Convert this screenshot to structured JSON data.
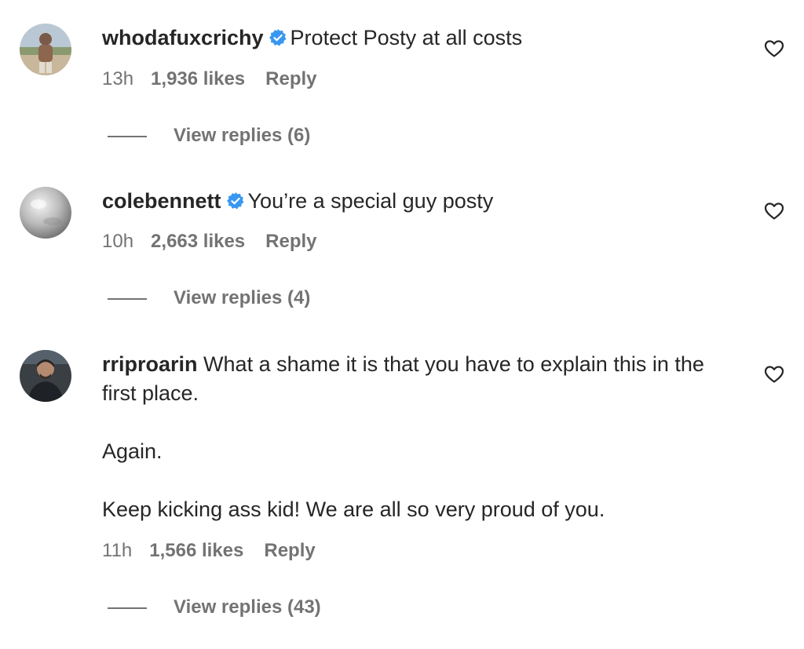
{
  "comments": [
    {
      "username": "whodafuxcrichy",
      "verified": true,
      "text": "Protect Posty at all costs",
      "time": "13h",
      "likes": "1,936 likes",
      "reply_label": "Reply",
      "view_replies": "View replies (6)"
    },
    {
      "username": "colebennett",
      "verified": true,
      "text": "You’re a special guy posty",
      "time": "10h",
      "likes": "2,663 likes",
      "reply_label": "Reply",
      "view_replies": "View replies (4)"
    },
    {
      "username": "rriproarin",
      "verified": false,
      "text": "What a shame it is that you have to explain this in the first place.",
      "paragraphs": [
        "Again.",
        "Keep kicking ass kid! We are all so very proud of you."
      ],
      "time": "11h",
      "likes": "1,566 likes",
      "reply_label": "Reply",
      "view_replies": "View replies (43)"
    }
  ],
  "colors": {
    "text": "#262626",
    "secondary": "#737373",
    "verified": "#3897f0"
  }
}
